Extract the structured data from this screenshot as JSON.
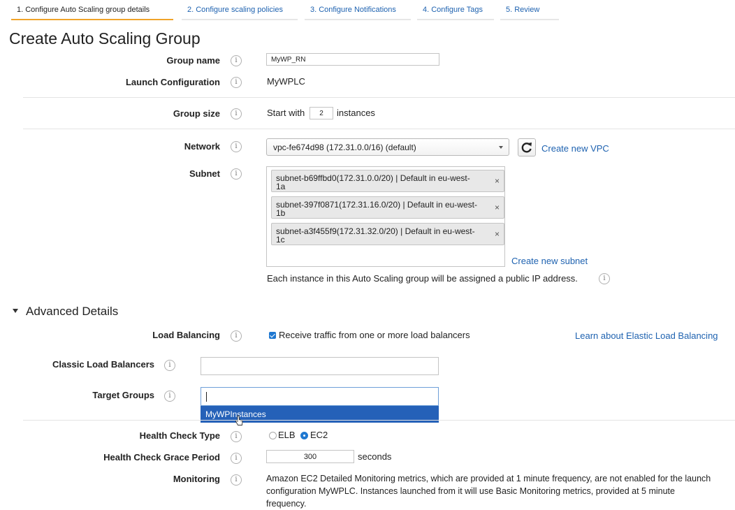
{
  "tabs": [
    {
      "label": "1. Configure Auto Scaling group details",
      "active": true
    },
    {
      "label": "2. Configure scaling policies",
      "active": false
    },
    {
      "label": "3. Configure Notifications",
      "active": false
    },
    {
      "label": "4. Configure Tags",
      "active": false
    },
    {
      "label": "5. Review",
      "active": false
    }
  ],
  "page_title": "Create Auto Scaling Group",
  "info_glyph": "i",
  "fields": {
    "group_name": {
      "label": "Group name",
      "value": "MyWP_RN"
    },
    "launch_configuration": {
      "label": "Launch Configuration",
      "value": "MyWPLC"
    },
    "group_size": {
      "label": "Group size",
      "prefix": "Start with",
      "value": "2",
      "suffix": "instances"
    },
    "network": {
      "label": "Network",
      "value": "vpc-fe674d98 (172.31.0.0/16) (default)",
      "create_link": "Create new VPC"
    },
    "subnet": {
      "label": "Subnet",
      "chips": [
        {
          "line1": "subnet-b69ffbd0(172.31.0.0/20) | Default in eu-west-",
          "line2": "1a"
        },
        {
          "line1": "subnet-397f0871(172.31.16.0/20) | Default in eu-west-",
          "line2": "1b"
        },
        {
          "line1": "subnet-a3f455f9(172.31.32.0/20) | Default in eu-west-",
          "line2": "1c"
        }
      ],
      "remove_glyph": "×",
      "create_link": "Create new subnet",
      "note": "Each instance in this Auto Scaling group will be assigned a public IP address."
    }
  },
  "advanced": {
    "heading": "Advanced Details",
    "load_balancing": {
      "label": "Load Balancing",
      "checkbox_label": "Receive traffic from one or more load balancers",
      "checked": true,
      "learn_link": "Learn about Elastic Load Balancing"
    },
    "classic_load_balancers": {
      "label": "Classic Load Balancers",
      "value": ""
    },
    "target_groups": {
      "label": "Target Groups",
      "value": "",
      "dropdown_option": "MyWPInstances"
    },
    "health_check_type": {
      "label": "Health Check Type",
      "options": [
        "ELB",
        "EC2"
      ],
      "selected": "EC2"
    },
    "health_check_grace": {
      "label": "Health Check Grace Period",
      "value": "300",
      "suffix": "seconds"
    },
    "monitoring": {
      "label": "Monitoring",
      "text": "Amazon EC2 Detailed Monitoring metrics, which are provided at 1 minute frequency, are not enabled for the launch configuration MyWPLC. Instances launched from it will use Basic Monitoring metrics, provided at 5 minute frequency."
    }
  },
  "colors": {
    "link": "#1e62b0",
    "accent_tab": "#f0a32a",
    "selection": "#2561b8",
    "control_blue": "#1f78d1"
  }
}
